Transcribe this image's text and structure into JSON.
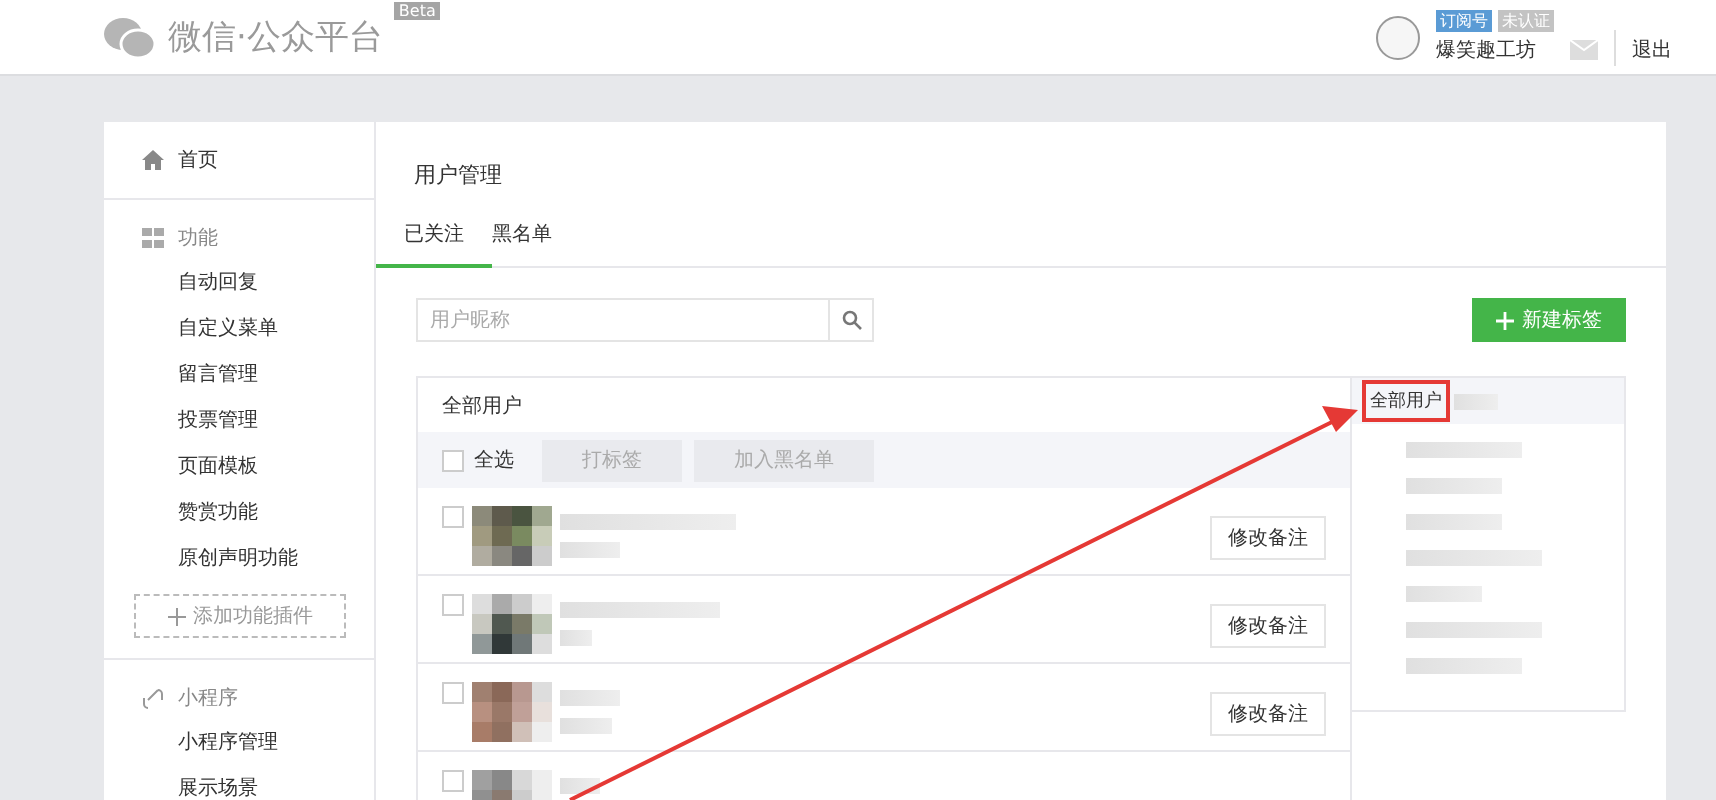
{
  "header": {
    "logo_text": "微信·公众平台",
    "badge": "Beta",
    "account_tags": [
      {
        "label": "订阅号",
        "kind": "type"
      },
      {
        "label": "未认证",
        "kind": "status"
      }
    ],
    "account_name": "爆笑趣工坊",
    "logout": "退出"
  },
  "sidebar": {
    "sections": [
      {
        "kind": "home",
        "label": "首页"
      },
      {
        "kind": "grid",
        "label": "功能",
        "children": [
          {
            "label": "自动回复"
          },
          {
            "label": "自定义菜单"
          },
          {
            "label": "留言管理"
          },
          {
            "label": "投票管理"
          },
          {
            "label": "页面模板"
          },
          {
            "label": "赞赏功能"
          },
          {
            "label": "原创声明功能"
          }
        ],
        "add_button": "添加功能插件"
      },
      {
        "kind": "link",
        "label": "小程序",
        "children": [
          {
            "label": "小程序管理"
          },
          {
            "label": "展示场景"
          }
        ]
      }
    ]
  },
  "page": {
    "title": "用户管理",
    "tabs": [
      {
        "label": "已关注",
        "selected": true
      },
      {
        "label": "黑名单",
        "selected": false
      }
    ],
    "search": {
      "placeholder": "用户昵称"
    },
    "new_tag_button": "新建标签",
    "table": {
      "title": "全部用户",
      "select_all": {
        "label": "全选",
        "checked": false
      },
      "bulk_buttons": [
        {
          "label": "打标签",
          "disabled": true
        },
        {
          "label": "加入黑名单",
          "disabled": true
        }
      ],
      "rows": [
        {
          "checked": false,
          "action": "修改备注"
        },
        {
          "checked": false,
          "action": "修改备注"
        },
        {
          "checked": false,
          "action": "修改备注"
        },
        {
          "checked": false
        }
      ]
    },
    "tag_panel": {
      "header": "全部用户",
      "highlighted": true
    }
  },
  "annotation_arrow": {
    "shown": true
  }
}
